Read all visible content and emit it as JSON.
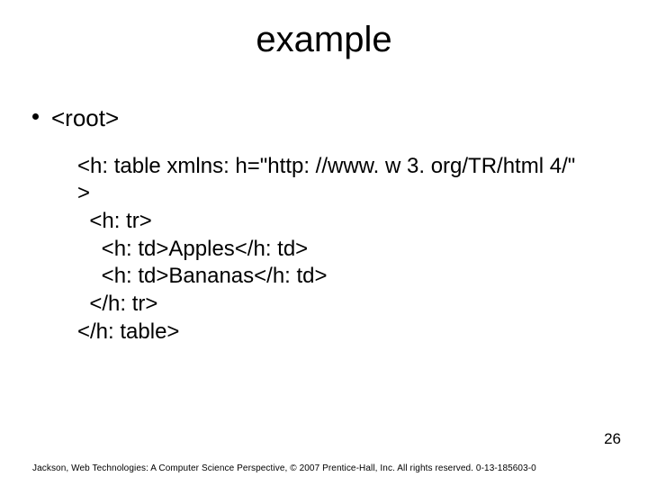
{
  "title": "example",
  "bullet": "<root>",
  "code": {
    "l1": "<h: table xmlns: h=\"http: //www. w 3. org/TR/html 4/\"",
    "l2": ">",
    "l3": "  <h: tr>",
    "l4": "    <h: td>Apples</h: td>",
    "l5": "    <h: td>Bananas</h: td>",
    "l6": "  </h: tr>",
    "l7": "</h: table>"
  },
  "page_number": "26",
  "footer": "Jackson, Web Technologies: A Computer Science Perspective, © 2007 Prentice-Hall, Inc. All rights reserved. 0-13-185603-0"
}
